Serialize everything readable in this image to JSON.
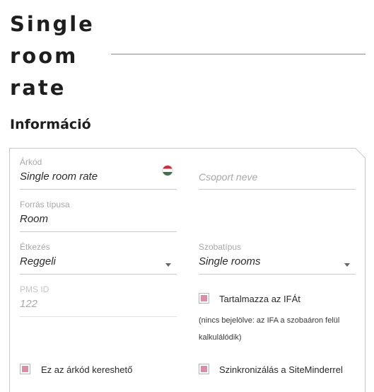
{
  "page": {
    "title_lines": [
      "Single",
      "room",
      "rate"
    ],
    "section_title": "Információ"
  },
  "form": {
    "rate_code": {
      "label": "Árkód",
      "value": "Single room rate",
      "flag": "hungary-flag-icon"
    },
    "group_name": {
      "placeholder": "Csoport neve"
    },
    "source_type": {
      "label": "Forrás típusa",
      "value": "Room"
    },
    "meal": {
      "label": "Étkezés",
      "value": "Reggeli"
    },
    "room_type": {
      "label": "Szobatípus",
      "value": "Single rooms"
    },
    "pms_id": {
      "label": "PMS ID",
      "value": "122"
    },
    "includes_vat": {
      "label": "Tartalmazza az IFÁt",
      "checked": true,
      "note": "(nincs bejelölve: az IFA a szobaáron felül kalkulálódik)"
    },
    "searchable": {
      "label": "Ez az árkód kereshető",
      "checked": true
    },
    "siteminder_sync": {
      "label": "Szinkronizálás a SiteMinderrel",
      "checked": true
    }
  },
  "colors": {
    "checkbox_fill": "#d98ea6",
    "border": "#c9c9c9",
    "label": "#a8a8a8"
  }
}
